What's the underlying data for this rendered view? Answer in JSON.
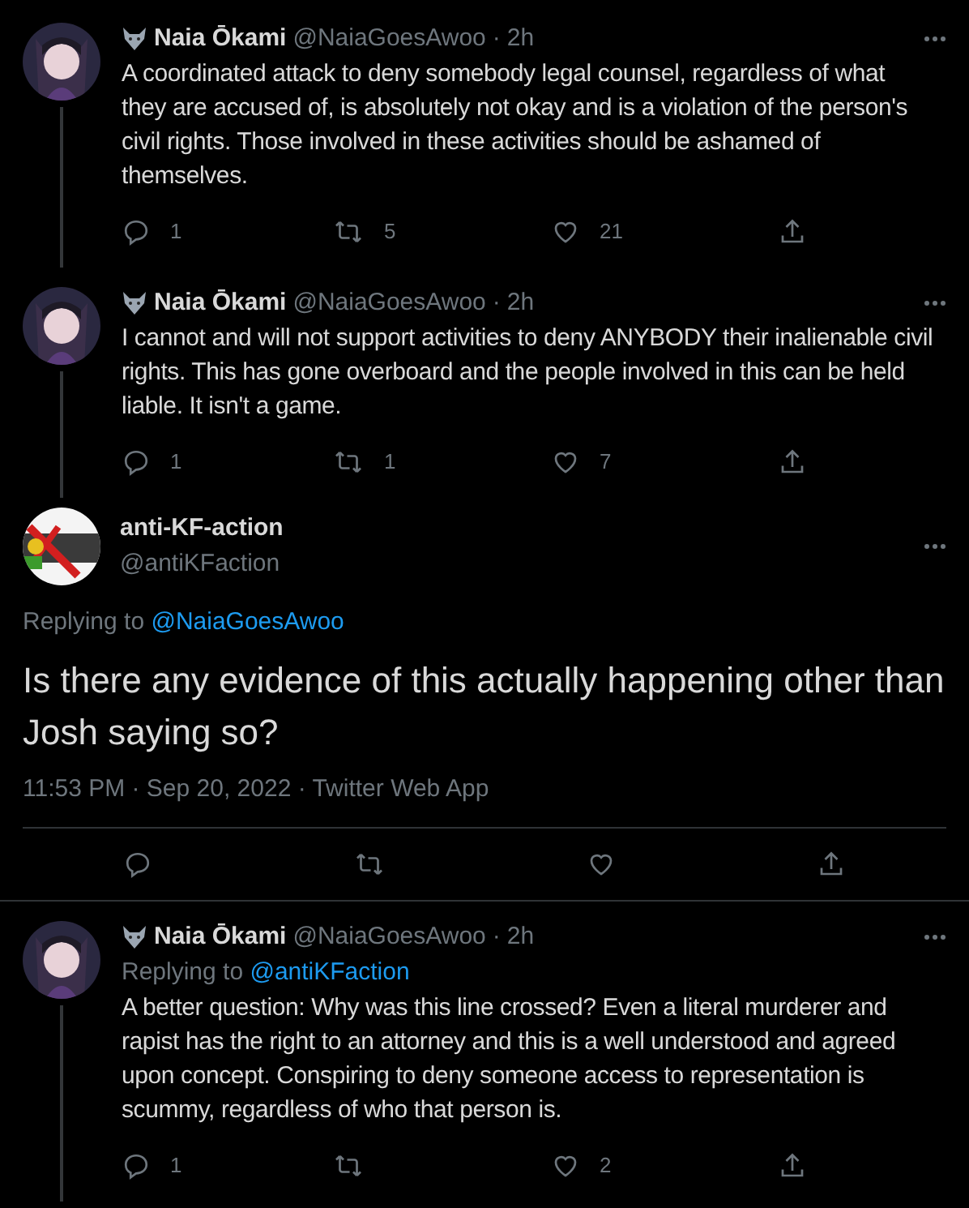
{
  "tweets": [
    {
      "kind": "thread",
      "name": "Naia Ōkami",
      "handle": "@NaiaGoesAwoo",
      "dot": "·",
      "time": "2h",
      "text": "A coordinated attack to deny somebody legal counsel, regardless of what they are accused of, is absolutely not okay and is a violation of the person's civil rights. Those involved in these activities should be ashamed of themselves.",
      "replies": "1",
      "retweets": "5",
      "likes": "21"
    },
    {
      "kind": "thread",
      "name": "Naia Ōkami",
      "handle": "@NaiaGoesAwoo",
      "dot": "·",
      "time": "2h",
      "text": "I cannot and will not support activities to deny ANYBODY their inalienable civil rights. This has gone overboard and the people involved in this can be held liable. It isn't a game.",
      "replies": "1",
      "retweets": "1",
      "likes": "7"
    },
    {
      "kind": "focused",
      "name": "anti-KF-action",
      "handle": "@antiKFaction",
      "replying_label": "Replying to",
      "replying_to": "@NaiaGoesAwoo",
      "text": "Is there any evidence of this actually happening other than Josh saying so?",
      "timestamp": "11:53 PM · Sep 20, 2022 · Twitter Web App"
    },
    {
      "kind": "thread",
      "name": "Naia Ōkami",
      "handle": "@NaiaGoesAwoo",
      "dot": "·",
      "time": "2h",
      "replying_label": "Replying to",
      "replying_to": "@antiKFaction",
      "text": "A better question: Why was this line crossed? Even a literal murderer and rapist has the right to an attorney and this is a well understood and agreed upon concept. Conspiring to deny someone access to representation is scummy, regardless of who that person is.",
      "replies": "1",
      "likes": "2"
    }
  ]
}
